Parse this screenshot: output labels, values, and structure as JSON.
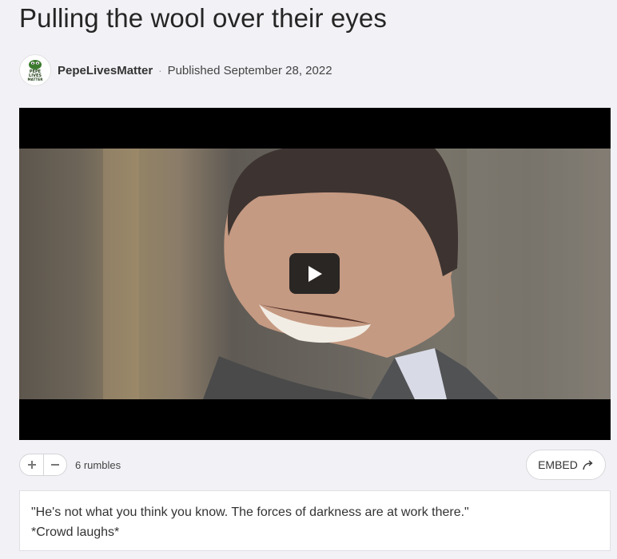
{
  "video": {
    "title": "Pulling the wool over their eyes",
    "channel": "PepeLivesMatter",
    "separator": "·",
    "published": "Published September 28, 2022",
    "avatar_text": [
      "PEPE",
      "LIVES",
      "MATTER"
    ],
    "icon": "play-icon"
  },
  "actions": {
    "upvote_icon": "plus-icon",
    "downvote_icon": "minus-icon",
    "rumbles": "6 rumbles",
    "embed_label": "EMBED",
    "embed_icon": "share-arrow-icon"
  },
  "description": {
    "line1": "\"He's not what you think you know. The forces of darkness are at work there.\"",
    "line2": "*Crowd laughs*"
  },
  "colors": {
    "page_bg": "#f2f1f6",
    "text": "#252525",
    "player_bg": "#000000"
  }
}
